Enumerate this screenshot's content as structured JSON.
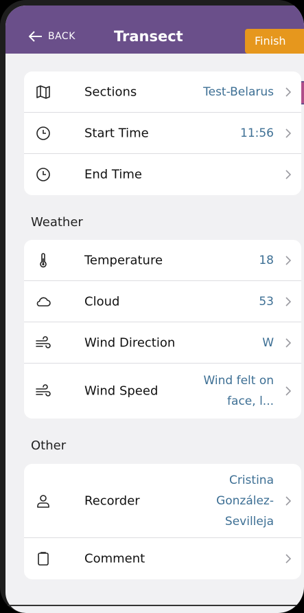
{
  "header": {
    "back_label": "BACK",
    "title": "Transect",
    "finish_label": "Finish"
  },
  "colors": {
    "header_bg": "#6a4f8a",
    "finish_bg": "#e6971d",
    "value_text": "#3d6f94",
    "tab_marker": "#b04e8a"
  },
  "details": {
    "sections": {
      "label": "Sections",
      "value": "Test-Belarus",
      "icon": "map-icon"
    },
    "start_time": {
      "label": "Start Time",
      "value": "11:56",
      "icon": "clock-icon"
    },
    "end_time": {
      "label": "End Time",
      "value": "",
      "icon": "clock-icon"
    }
  },
  "weather": {
    "heading": "Weather",
    "temperature": {
      "label": "Temperature",
      "value": "18",
      "icon": "thermometer-icon"
    },
    "cloud": {
      "label": "Cloud",
      "value": "53",
      "icon": "cloud-icon"
    },
    "wind_direction": {
      "label": "Wind Direction",
      "value": "W",
      "icon": "wind-icon"
    },
    "wind_speed": {
      "label": "Wind Speed",
      "value_line1": "Wind felt on",
      "value_line2": "face, l...",
      "icon": "wind-icon"
    }
  },
  "other": {
    "heading": "Other",
    "recorder": {
      "label": "Recorder",
      "value_line1": "Cristina",
      "value_line2": "González-",
      "value_line3": "Sevilleja",
      "icon": "person-icon"
    },
    "comment": {
      "label": "Comment",
      "value": "",
      "icon": "clipboard-icon"
    }
  }
}
